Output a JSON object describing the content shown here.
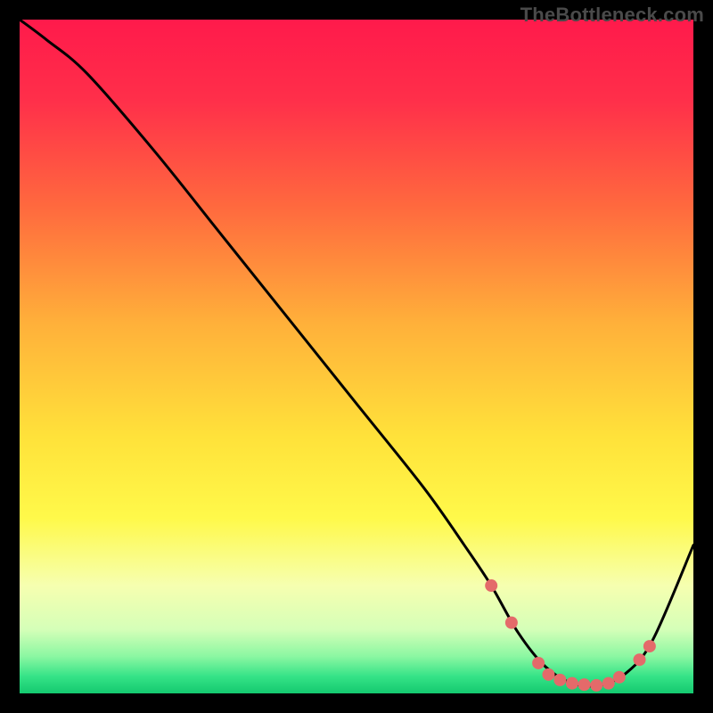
{
  "watermark": "TheBottleneck.com",
  "chart_data": {
    "type": "line",
    "title": "",
    "xlabel": "",
    "ylabel": "",
    "xlim": [
      0,
      100
    ],
    "ylim": [
      0,
      100
    ],
    "grid": false,
    "legend": false,
    "series": [
      {
        "name": "curve",
        "x": [
          0,
          4,
          10,
          20,
          30,
          40,
          50,
          60,
          66,
          70,
          74,
          78,
          82,
          86,
          90,
          94,
          100
        ],
        "y": [
          100,
          97,
          92,
          80.5,
          68,
          55.5,
          43,
          30.5,
          22,
          16,
          9,
          4,
          1.5,
          1.2,
          3,
          8,
          22
        ]
      }
    ],
    "markers": {
      "name": "highlight-dots",
      "color": "#e46a6a",
      "points": [
        {
          "x": 70,
          "y": 16
        },
        {
          "x": 73,
          "y": 10.5
        },
        {
          "x": 77,
          "y": 4.5
        },
        {
          "x": 78.5,
          "y": 2.8
        },
        {
          "x": 80.2,
          "y": 2.0
        },
        {
          "x": 82,
          "y": 1.5
        },
        {
          "x": 83.8,
          "y": 1.3
        },
        {
          "x": 85.6,
          "y": 1.2
        },
        {
          "x": 87.4,
          "y": 1.5
        },
        {
          "x": 89,
          "y": 2.4
        },
        {
          "x": 92,
          "y": 5
        },
        {
          "x": 93.5,
          "y": 7
        }
      ]
    },
    "gradient_stops": [
      {
        "offset": 0.0,
        "color": "#ff1a4b"
      },
      {
        "offset": 0.12,
        "color": "#ff2f4a"
      },
      {
        "offset": 0.28,
        "color": "#ff6a3e"
      },
      {
        "offset": 0.45,
        "color": "#ffb03a"
      },
      {
        "offset": 0.62,
        "color": "#ffe23a"
      },
      {
        "offset": 0.74,
        "color": "#fff94a"
      },
      {
        "offset": 0.84,
        "color": "#f6ffb0"
      },
      {
        "offset": 0.905,
        "color": "#d5ffb8"
      },
      {
        "offset": 0.945,
        "color": "#8bf7a2"
      },
      {
        "offset": 0.975,
        "color": "#35e387"
      },
      {
        "offset": 1.0,
        "color": "#14c96f"
      }
    ]
  }
}
